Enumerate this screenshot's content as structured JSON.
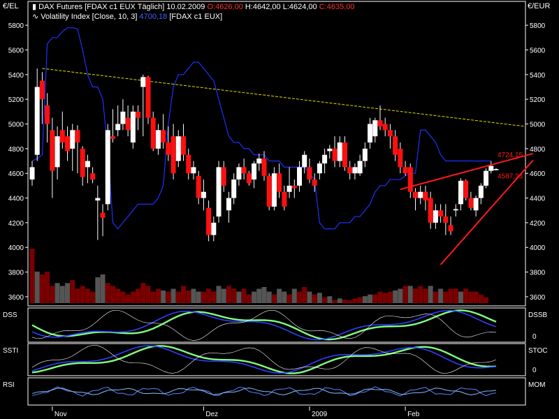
{
  "header": {
    "unit_left": "€/EL",
    "unit_right": "€/EUR",
    "line1": {
      "symbol": "DAX Futures [FDAX c1 EUX  Täglich]",
      "date": "10.02.2009",
      "open": "O:4626,00",
      "high": "H:4642,00",
      "low": "L:4624,00",
      "close": "C:4635,00"
    },
    "line2": {
      "name": "Volatility Index [Close, 10, 3]",
      "value": "4700,18",
      "suffix": "[FDAX c1 EUX]"
    }
  },
  "colors": {
    "background": "#000000",
    "up_candle": "#ffffff",
    "down_candle": "#ff1010",
    "volatility_line": "#2030ff",
    "trend_line": "#e0e000",
    "trendline_red": "#ff1a1a",
    "volume_up": "#555555",
    "volume_down": "#7a0000",
    "green": "#80ff80",
    "blue": "#3040ff",
    "panel_border": "#ffffff"
  },
  "chart_data": {
    "type": "candlestick",
    "y_ticks": [
      "5800",
      "5600",
      "5400",
      "5200",
      "5000",
      "4800",
      "4600",
      "4400",
      "4200",
      "4000",
      "3800",
      "3600"
    ],
    "x_labels": [
      "Nov",
      "Dez",
      "2009",
      "Feb"
    ],
    "ylim": [
      3560,
      5880
    ],
    "candles": [
      {
        "o": 4550,
        "h": 4700,
        "l": 4500,
        "c": 4650
      },
      {
        "o": 4750,
        "h": 5450,
        "l": 4700,
        "c": 5300
      },
      {
        "o": 5350,
        "h": 5420,
        "l": 5000,
        "c": 5200
      },
      {
        "o": 5150,
        "h": 5250,
        "l": 4850,
        "c": 5000
      },
      {
        "o": 4950,
        "h": 5050,
        "l": 4400,
        "c": 4620
      },
      {
        "o": 4650,
        "h": 4980,
        "l": 4550,
        "c": 4900
      },
      {
        "o": 4950,
        "h": 5100,
        "l": 4800,
        "c": 4850
      },
      {
        "o": 4900,
        "h": 4980,
        "l": 4700,
        "c": 4780
      },
      {
        "o": 4800,
        "h": 5000,
        "l": 4620,
        "c": 4950
      },
      {
        "o": 4950,
        "h": 4990,
        "l": 4600,
        "c": 4850
      },
      {
        "o": 4800,
        "h": 4820,
        "l": 4500,
        "c": 4570
      },
      {
        "o": 4650,
        "h": 4750,
        "l": 4520,
        "c": 4700
      },
      {
        "o": 4600,
        "h": 4650,
        "l": 4520,
        "c": 4550
      },
      {
        "o": 4380,
        "h": 4500,
        "l": 4060,
        "c": 4400
      },
      {
        "o": 4280,
        "h": 4350,
        "l": 4090,
        "c": 4240
      },
      {
        "o": 4350,
        "h": 5000,
        "l": 4300,
        "c": 4950
      },
      {
        "o": 4900,
        "h": 5120,
        "l": 4850,
        "c": 4880
      },
      {
        "o": 4950,
        "h": 5150,
        "l": 4900,
        "c": 5000
      },
      {
        "o": 5000,
        "h": 5200,
        "l": 4950,
        "c": 5100
      },
      {
        "o": 5050,
        "h": 5150,
        "l": 4900,
        "c": 4950
      },
      {
        "o": 4850,
        "h": 5150,
        "l": 4800,
        "c": 5100
      },
      {
        "o": 5100,
        "h": 5150,
        "l": 4950,
        "c": 5050
      },
      {
        "o": 5300,
        "h": 5400,
        "l": 4900,
        "c": 5380
      },
      {
        "o": 5380,
        "h": 5390,
        "l": 5000,
        "c": 5050
      },
      {
        "o": 5050,
        "h": 5100,
        "l": 4780,
        "c": 4800
      },
      {
        "o": 4800,
        "h": 5000,
        "l": 4750,
        "c": 4950
      },
      {
        "o": 4950,
        "h": 5080,
        "l": 4800,
        "c": 4850
      },
      {
        "o": 4850,
        "h": 4980,
        "l": 4700,
        "c": 4750
      },
      {
        "o": 4900,
        "h": 5000,
        "l": 4550,
        "c": 4600
      },
      {
        "o": 4700,
        "h": 4950,
        "l": 4650,
        "c": 4900
      },
      {
        "o": 4900,
        "h": 5000,
        "l": 4700,
        "c": 4750
      },
      {
        "o": 4750,
        "h": 4800,
        "l": 4550,
        "c": 4600
      },
      {
        "o": 4600,
        "h": 4700,
        "l": 4550,
        "c": 4650
      },
      {
        "o": 4580,
        "h": 4620,
        "l": 4350,
        "c": 4400
      },
      {
        "o": 4400,
        "h": 4550,
        "l": 4300,
        "c": 4450
      },
      {
        "o": 4320,
        "h": 4380,
        "l": 4050,
        "c": 4100
      },
      {
        "o": 4100,
        "h": 4250,
        "l": 4050,
        "c": 4200
      },
      {
        "o": 4250,
        "h": 4700,
        "l": 4200,
        "c": 4650
      },
      {
        "o": 4650,
        "h": 4700,
        "l": 4450,
        "c": 4500
      },
      {
        "o": 4300,
        "h": 4450,
        "l": 4200,
        "c": 4400
      },
      {
        "o": 4400,
        "h": 4600,
        "l": 4350,
        "c": 4550
      },
      {
        "o": 4550,
        "h": 4680,
        "l": 4500,
        "c": 4650
      },
      {
        "o": 4650,
        "h": 4720,
        "l": 4550,
        "c": 4600
      },
      {
        "o": 4600,
        "h": 4620,
        "l": 4500,
        "c": 4520
      },
      {
        "o": 4550,
        "h": 4700,
        "l": 4480,
        "c": 4680
      },
      {
        "o": 4680,
        "h": 4760,
        "l": 4620,
        "c": 4720
      },
      {
        "o": 4720,
        "h": 4780,
        "l": 4540,
        "c": 4580
      },
      {
        "o": 4580,
        "h": 4600,
        "l": 4300,
        "c": 4330
      },
      {
        "o": 4330,
        "h": 4650,
        "l": 4300,
        "c": 4600
      },
      {
        "o": 4600,
        "h": 4680,
        "l": 4400,
        "c": 4450
      },
      {
        "o": 4450,
        "h": 4500,
        "l": 4300,
        "c": 4330
      },
      {
        "o": 4450,
        "h": 4650,
        "l": 4400,
        "c": 4500
      },
      {
        "o": 4500,
        "h": 4550,
        "l": 4400,
        "c": 4480
      },
      {
        "o": 4500,
        "h": 4700,
        "l": 4450,
        "c": 4650
      },
      {
        "o": 4650,
        "h": 4780,
        "l": 4600,
        "c": 4750
      },
      {
        "o": 4650,
        "h": 4720,
        "l": 4520,
        "c": 4550
      },
      {
        "o": 4550,
        "h": 4600,
        "l": 4450,
        "c": 4500
      },
      {
        "o": 4600,
        "h": 4700,
        "l": 4550,
        "c": 4680
      },
      {
        "o": 4680,
        "h": 4800,
        "l": 4600,
        "c": 4750
      },
      {
        "o": 4780,
        "h": 4830,
        "l": 4720,
        "c": 4800
      },
      {
        "o": 4800,
        "h": 4900,
        "l": 4650,
        "c": 4700
      },
      {
        "o": 4700,
        "h": 4900,
        "l": 4650,
        "c": 4850
      },
      {
        "o": 4850,
        "h": 4900,
        "l": 4620,
        "c": 4650
      },
      {
        "o": 4650,
        "h": 4700,
        "l": 4550,
        "c": 4600
      },
      {
        "o": 4600,
        "h": 4680,
        "l": 4550,
        "c": 4650
      },
      {
        "o": 4600,
        "h": 4750,
        "l": 4580,
        "c": 4700
      },
      {
        "o": 4700,
        "h": 4850,
        "l": 4650,
        "c": 4800
      },
      {
        "o": 4850,
        "h": 5050,
        "l": 4800,
        "c": 5000
      },
      {
        "o": 4900,
        "h": 5050,
        "l": 4850,
        "c": 5030
      },
      {
        "o": 5030,
        "h": 5150,
        "l": 4950,
        "c": 4980
      },
      {
        "o": 5000,
        "h": 5050,
        "l": 4900,
        "c": 4950
      },
      {
        "o": 4950,
        "h": 5000,
        "l": 4800,
        "c": 4900
      },
      {
        "o": 4900,
        "h": 4950,
        "l": 4700,
        "c": 4750
      },
      {
        "o": 4800,
        "h": 4850,
        "l": 4600,
        "c": 4650
      },
      {
        "o": 4650,
        "h": 4700,
        "l": 4580,
        "c": 4600
      },
      {
        "o": 4650,
        "h": 4680,
        "l": 4400,
        "c": 4450
      },
      {
        "o": 4450,
        "h": 4480,
        "l": 4300,
        "c": 4400
      },
      {
        "o": 4400,
        "h": 4500,
        "l": 4350,
        "c": 4450
      },
      {
        "o": 4450,
        "h": 4500,
        "l": 4300,
        "c": 4380
      },
      {
        "o": 4400,
        "h": 4450,
        "l": 4150,
        "c": 4200
      },
      {
        "o": 4200,
        "h": 4350,
        "l": 4150,
        "c": 4300
      },
      {
        "o": 4300,
        "h": 4350,
        "l": 4200,
        "c": 4250
      },
      {
        "o": 4250,
        "h": 4350,
        "l": 4100,
        "c": 4200
      },
      {
        "o": 4180,
        "h": 4250,
        "l": 4100,
        "c": 4130
      },
      {
        "o": 4300,
        "h": 4350,
        "l": 4250,
        "c": 4310
      },
      {
        "o": 4350,
        "h": 4560,
        "l": 4300,
        "c": 4540
      },
      {
        "o": 4540,
        "h": 4550,
        "l": 4380,
        "c": 4400
      },
      {
        "o": 4400,
        "h": 4450,
        "l": 4300,
        "c": 4320
      },
      {
        "o": 4300,
        "h": 4420,
        "l": 4250,
        "c": 4400
      },
      {
        "o": 4400,
        "h": 4520,
        "l": 4350,
        "c": 4500
      },
      {
        "o": 4500,
        "h": 4640,
        "l": 4480,
        "c": 4620
      },
      {
        "o": 4620,
        "h": 4700,
        "l": 4600,
        "c": 4660
      },
      {
        "o": 4626,
        "h": 4642,
        "l": 4624,
        "c": 4635
      }
    ],
    "trend_line": {
      "start": 5450,
      "end": 4980
    },
    "volatility": [
      4700,
      4720,
      4750,
      5650,
      5700,
      5700,
      5750,
      5780,
      5780,
      5770,
      5600,
      5400,
      5300,
      5300,
      5200,
      4800,
      4200,
      4150,
      4200,
      4250,
      4300,
      4350,
      4350,
      4350,
      4350,
      4400,
      4500,
      5000,
      5300,
      5400,
      5400,
      5450,
      5500,
      5500,
      5450,
      5400,
      5350,
      5200,
      5050,
      4900,
      4850,
      4850,
      4800,
      4800,
      4750,
      4750,
      4750,
      4700,
      4700,
      4700,
      4650,
      4650,
      4650,
      4650,
      4650,
      4600,
      4550,
      4200,
      4150,
      4150,
      4150,
      4200,
      4200,
      4200,
      4250,
      4250,
      4300,
      4350,
      4450,
      4500,
      4500,
      4550,
      4550,
      4550,
      4580,
      4600,
      4600,
      4950,
      4950,
      4900,
      4850,
      4750,
      4700,
      4700,
      4700,
      4700,
      4700,
      4700,
      4700,
      4700,
      4700,
      4700
    ],
    "volume": [
      {
        "v": 0.95,
        "up": false
      },
      {
        "v": 0.55,
        "up": true
      },
      {
        "v": 0.5,
        "up": false
      },
      {
        "v": 0.55,
        "up": false
      },
      {
        "v": 0.3,
        "up": false
      },
      {
        "v": 0.35,
        "up": true
      },
      {
        "v": 0.3,
        "up": true
      },
      {
        "v": 0.35,
        "up": true
      },
      {
        "v": 0.4,
        "up": false
      },
      {
        "v": 0.25,
        "up": false
      },
      {
        "v": 0.3,
        "up": false
      },
      {
        "v": 0.25,
        "up": false
      },
      {
        "v": 0.2,
        "up": false
      },
      {
        "v": 0.45,
        "up": true
      },
      {
        "v": 0.5,
        "up": true
      },
      {
        "v": 0.35,
        "up": false
      },
      {
        "v": 0.3,
        "up": false
      },
      {
        "v": 0.25,
        "up": false
      },
      {
        "v": 0.2,
        "up": false
      },
      {
        "v": 0.15,
        "up": false
      },
      {
        "v": 0.2,
        "up": false
      },
      {
        "v": 0.25,
        "up": false
      },
      {
        "v": 0.35,
        "up": false
      },
      {
        "v": 0.3,
        "up": false
      },
      {
        "v": 0.2,
        "up": false
      },
      {
        "v": 0.25,
        "up": false
      },
      {
        "v": 0.22,
        "up": true
      },
      {
        "v": 0.2,
        "up": false
      },
      {
        "v": 0.25,
        "up": true
      },
      {
        "v": 0.2,
        "up": false
      },
      {
        "v": 0.3,
        "up": false
      },
      {
        "v": 0.22,
        "up": false
      },
      {
        "v": 0.25,
        "up": true
      },
      {
        "v": 0.2,
        "up": true
      },
      {
        "v": 0.2,
        "up": false
      },
      {
        "v": 0.25,
        "up": false
      },
      {
        "v": 0.2,
        "up": false
      },
      {
        "v": 0.3,
        "up": true
      },
      {
        "v": 0.25,
        "up": true
      },
      {
        "v": 0.3,
        "up": false
      },
      {
        "v": 0.25,
        "up": false
      },
      {
        "v": 0.2,
        "up": true
      },
      {
        "v": 0.25,
        "up": false
      },
      {
        "v": 0.15,
        "up": false
      },
      {
        "v": 0.2,
        "up": true
      },
      {
        "v": 0.25,
        "up": true
      },
      {
        "v": 0.28,
        "up": true
      },
      {
        "v": 0.2,
        "up": true
      },
      {
        "v": 0.15,
        "up": false
      },
      {
        "v": 0.25,
        "up": true
      },
      {
        "v": 0.2,
        "up": true
      },
      {
        "v": 0.15,
        "up": false
      },
      {
        "v": 0.25,
        "up": true
      },
      {
        "v": 0.2,
        "up": false
      },
      {
        "v": 0.28,
        "up": false
      },
      {
        "v": 0.2,
        "up": true
      },
      {
        "v": 0.15,
        "up": false
      },
      {
        "v": 0.18,
        "up": true
      },
      {
        "v": 0.1,
        "up": false
      },
      {
        "v": 0.12,
        "up": true
      },
      {
        "v": 0.05,
        "up": false
      },
      {
        "v": 0.08,
        "up": true
      },
      {
        "v": 0.06,
        "up": false
      },
      {
        "v": 0.05,
        "up": false
      },
      {
        "v": 0.08,
        "up": false
      },
      {
        "v": 0.1,
        "up": false
      },
      {
        "v": 0.12,
        "up": true
      },
      {
        "v": 0.15,
        "up": true
      },
      {
        "v": 0.15,
        "up": false
      },
      {
        "v": 0.2,
        "up": false
      },
      {
        "v": 0.18,
        "up": false
      },
      {
        "v": 0.2,
        "up": false
      },
      {
        "v": 0.22,
        "up": true
      },
      {
        "v": 0.25,
        "up": true
      },
      {
        "v": 0.3,
        "up": false
      },
      {
        "v": 0.3,
        "up": true
      },
      {
        "v": 0.25,
        "up": false
      },
      {
        "v": 0.3,
        "up": false
      },
      {
        "v": 0.25,
        "up": false
      },
      {
        "v": 0.3,
        "up": true
      },
      {
        "v": 0.2,
        "up": false
      },
      {
        "v": 0.25,
        "up": true
      },
      {
        "v": 0.2,
        "up": false
      },
      {
        "v": 0.25,
        "up": false
      },
      {
        "v": 0.25,
        "up": false
      },
      {
        "v": 0.2,
        "up": true
      },
      {
        "v": 0.25,
        "up": false
      },
      {
        "v": 0.2,
        "up": false
      },
      {
        "v": 0.2,
        "up": false
      },
      {
        "v": 0.15,
        "up": false
      },
      {
        "v": 0.1,
        "up": false
      }
    ],
    "wedge": {
      "upper": {
        "from": [
          73,
          4470
        ],
        "to": [
          96,
          4760
        ]
      },
      "lower": {
        "from": [
          81,
          3860
        ],
        "to": [
          96,
          4650
        ]
      },
      "labels": [
        "4724,15",
        "4587,33"
      ]
    },
    "panels": [
      {
        "left": "DSS",
        "right": "DSSB",
        "zero": "0"
      },
      {
        "left": "SSTI",
        "right": "STOC",
        "zero": "0"
      },
      {
        "left": "RSI",
        "right": "MOM",
        "zero": ""
      }
    ]
  }
}
